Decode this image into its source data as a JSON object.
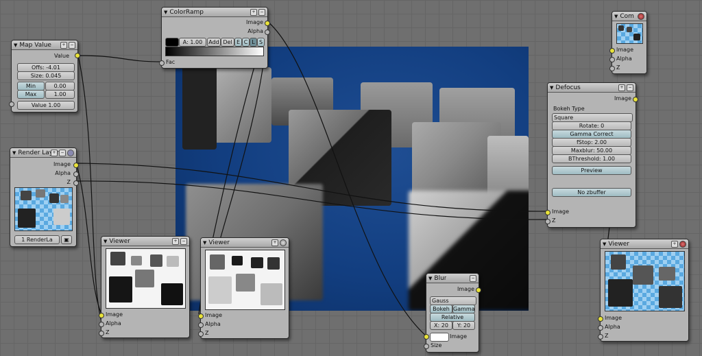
{
  "colorramp": {
    "title": "ColorRamp",
    "outputs": [
      "Image",
      "Alpha"
    ],
    "input": "Fac",
    "alpha_field": "A: 1.00",
    "add_label": "Add",
    "del_label": "Del",
    "e_label": "E",
    "c_label": "C",
    "l_label": "L",
    "s_label": "S"
  },
  "mapvalue": {
    "title": "Map Value",
    "output": "Value",
    "offs": "Offs: -4.01",
    "size": "Size: 0.045",
    "min_label": "Min",
    "min_value": "0.00",
    "max_label": "Max",
    "max_value": "1.00",
    "input_value": "Value 1.00"
  },
  "renderlayer": {
    "title": "Render Layer",
    "outputs": [
      "Image",
      "Alpha",
      "Z"
    ],
    "layer_select": "1 RenderLa"
  },
  "composite": {
    "title": "Com",
    "inputs": [
      "Image",
      "Alpha",
      "Z"
    ]
  },
  "defocus": {
    "title": "Defocus",
    "output": "Image",
    "bokeh_type_label": "Bokeh Type",
    "bokeh_type_value": "Square",
    "rotate": "Rotate: 0",
    "gamma_correct": "Gamma Correct",
    "fstop": "fStop: 2.00",
    "maxblur": "Maxblur: 50.00",
    "bthreshold": "BThreshold: 1.00",
    "preview": "Preview",
    "no_zbuffer": "No zbuffer",
    "inputs": [
      "Image",
      "Z"
    ]
  },
  "viewer1": {
    "title": "Viewer",
    "inputs": [
      "Image",
      "Alpha",
      "Z"
    ]
  },
  "viewer2": {
    "title": "Viewer",
    "inputs": [
      "Image",
      "Alpha",
      "Z"
    ]
  },
  "viewer3": {
    "title": "Viewer",
    "inputs": [
      "Image",
      "Alpha",
      "Z"
    ]
  },
  "blur": {
    "title": "Blur",
    "output": "Image",
    "filter": "Gauss",
    "bokeh": "Bokeh",
    "gamma": "Gamma",
    "relative": "Relative",
    "x": "X: 20",
    "y": "Y: 20",
    "inputs": [
      "Image",
      "Size"
    ]
  },
  "colors": {
    "socket_image": "#e8e23a",
    "socket_value": "#b8b8b8",
    "backdrop_blue": "#123e80"
  }
}
